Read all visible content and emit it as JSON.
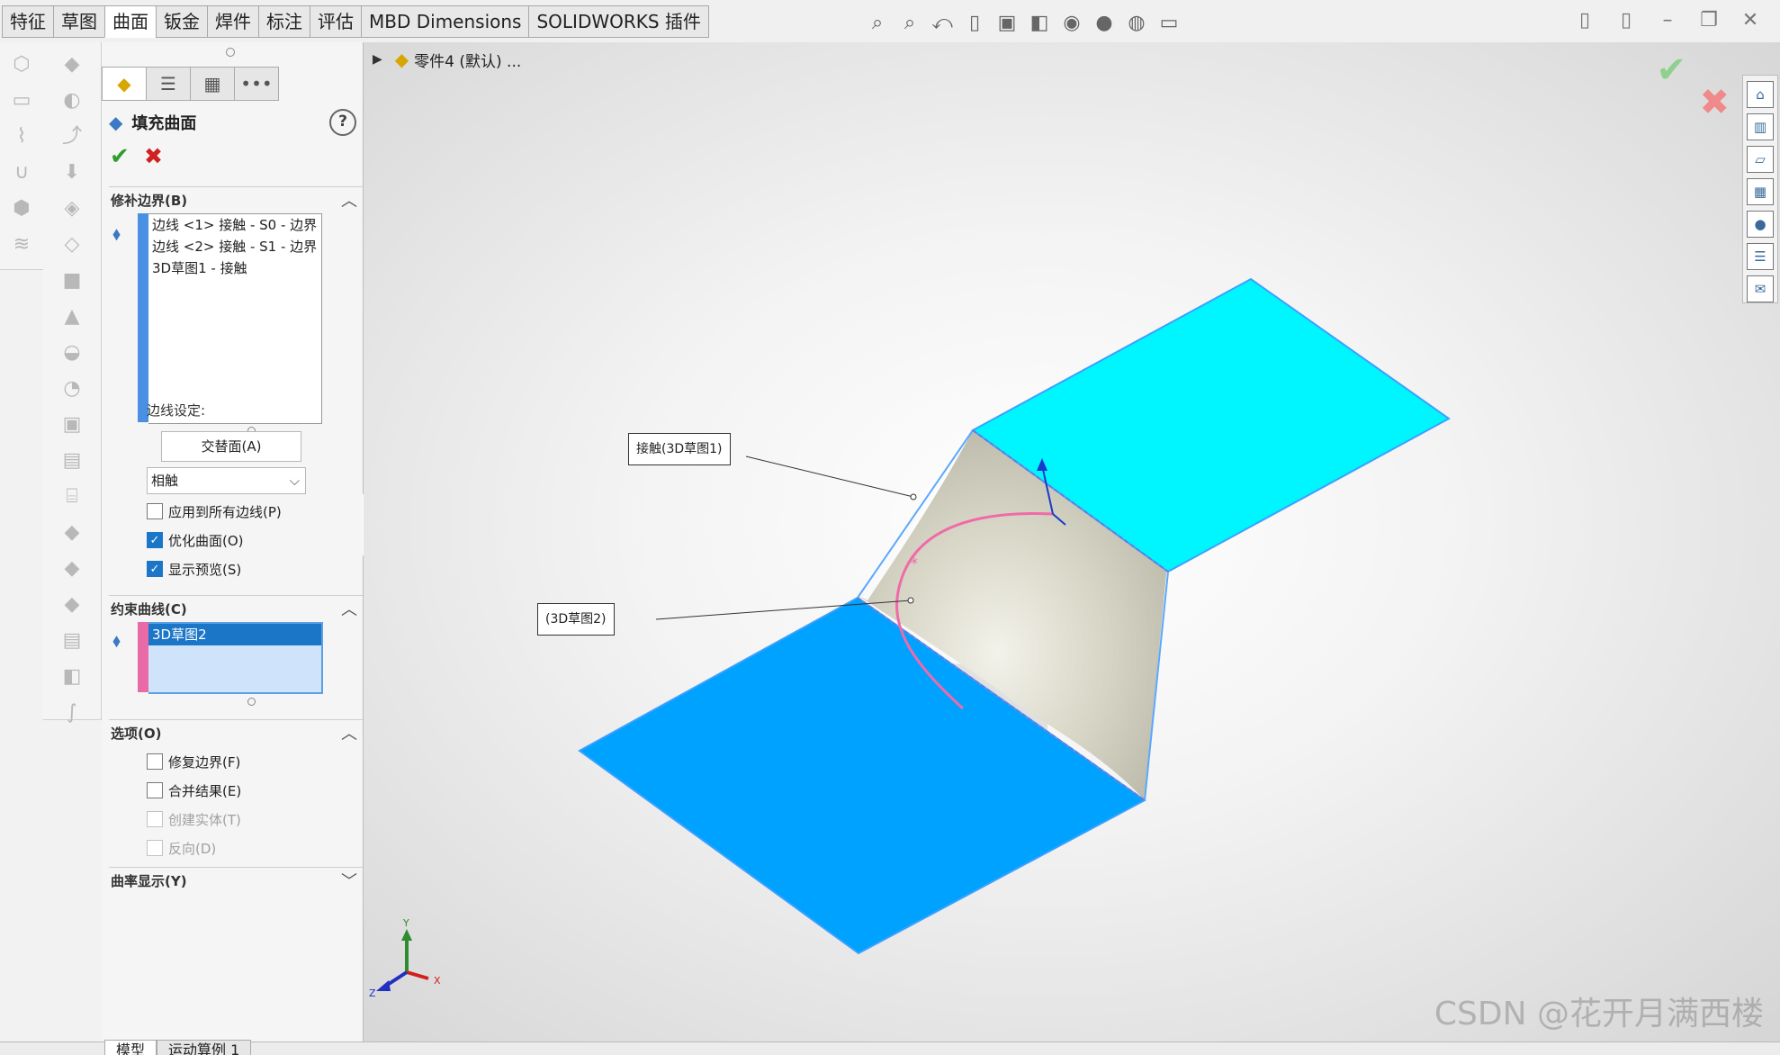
{
  "command_tabs": [
    {
      "label": "特征"
    },
    {
      "label": "草图"
    },
    {
      "label": "曲面",
      "active": true
    },
    {
      "label": "钣金"
    },
    {
      "label": "焊件"
    },
    {
      "label": "标注"
    },
    {
      "label": "评估"
    },
    {
      "label": "MBD Dimensions"
    },
    {
      "label": "SOLIDWORKS 插件"
    }
  ],
  "heads_up_icons": [
    "zoom-to-fit-icon",
    "zoom-area-icon",
    "previous-view-icon",
    "section-view-icon",
    "view-orientation-icon",
    "display-style-icon",
    "hide-show-icon",
    "appearance-icon",
    "scene-icon",
    "view-settings-icon"
  ],
  "window_icons": [
    "tile-left-icon",
    "tile-right-icon",
    "minimize-icon",
    "restore-icon",
    "close-icon"
  ],
  "feature_tree": {
    "part_label": "零件4 (默认) ..."
  },
  "property_manager": {
    "tabs": [
      "feature-manager-icon",
      "property-manager-icon",
      "configuration-manager-icon",
      "more-icon"
    ],
    "title": "填充曲面",
    "help": "?",
    "ok": "✔",
    "cancel": "✖",
    "patch_boundary": {
      "label": "修补边界(B)",
      "items": [
        "边线 <1> 接触 - S0 - 边界",
        "边线 <2> 接触 - S1 - 边界",
        "3D草图1 - 接触"
      ],
      "color": "#4a90e2"
    },
    "edge_settings_label": "边线设定:",
    "alternate_face_button": "交替面(A)",
    "contact_select_value": "相触",
    "checkboxes_top": [
      {
        "label": "应用到所有边线(P)",
        "checked": false
      },
      {
        "label": "优化曲面(O)",
        "checked": true
      },
      {
        "label": "显示预览(S)",
        "checked": true
      }
    ],
    "constraint_curves": {
      "label": "约束曲线(C)",
      "items": [
        "3D草图2"
      ],
      "color": "#e86aa6"
    },
    "options": {
      "label": "选项(O)",
      "checkboxes": [
        {
          "label": "修复边界(F)",
          "checked": false,
          "enabled": true
        },
        {
          "label": "合并结果(E)",
          "checked": false,
          "enabled": true
        },
        {
          "label": "创建实体(T)",
          "checked": false,
          "enabled": false
        },
        {
          "label": "反向(D)",
          "checked": false,
          "enabled": false
        }
      ]
    },
    "curvature_display": {
      "label": "曲率显示(Y)"
    }
  },
  "viewport": {
    "callout_1": "接触(3D草图1)",
    "callout_2": "(3D草图2)",
    "triad": {
      "x": "X",
      "y": "Y",
      "z": "Z"
    },
    "colors": {
      "top_surface": "#00f6ff",
      "bottom_surface": "#00a2ff",
      "fill_surface": "#d6d4c4",
      "constraint_curve": "#f06aa8"
    }
  },
  "task_pane_icons": [
    "home-icon",
    "library-icon",
    "file-explorer-icon",
    "view-palette-icon",
    "appearances-icon",
    "custom-properties-icon",
    "forum-icon"
  ],
  "bottom_tabs": [
    {
      "label": "模型",
      "active": true
    },
    {
      "label": "运动算例 1"
    }
  ],
  "watermark": "CSDN @花开月满西楼"
}
